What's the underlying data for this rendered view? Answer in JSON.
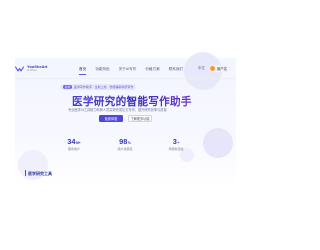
{
  "brand": {
    "name": "YouSheArt",
    "subtitle": "AI Writer",
    "color": "#2e3aa0"
  },
  "nav": {
    "items": [
      {
        "label": "首页",
        "active": true
      },
      {
        "label": "功能特色",
        "active": false
      },
      {
        "label": "关于AI写作",
        "active": false
      },
      {
        "label": "价格方案",
        "active": false
      },
      {
        "label": "联系我们",
        "active": false
      }
    ],
    "language": "中文",
    "user": "用户名"
  },
  "announcement": {
    "tag": "最新",
    "text": "医学写作助手 · 全新上线 · 智能辅助科研写作"
  },
  "hero": {
    "title": "医学研究的智能写作助手",
    "description": "专业医学AI工具助力科研人员高效完成论文写作，提升研究效率与质量",
    "primary_button": "免费体验",
    "secondary_button": "了解更多功能"
  },
  "stats": [
    {
      "value": "34",
      "unit": "M+",
      "label": "服务用户"
    },
    {
      "value": "98",
      "unit": "%",
      "label": "用户满意度"
    },
    {
      "value": "3",
      "unit": "+",
      "label": "年服务经验"
    }
  ],
  "section": {
    "title": "医学研究工具"
  },
  "colors": {
    "accent": "#4f47d8",
    "title": "#3d35b8",
    "avatar": "#f29a2e"
  }
}
